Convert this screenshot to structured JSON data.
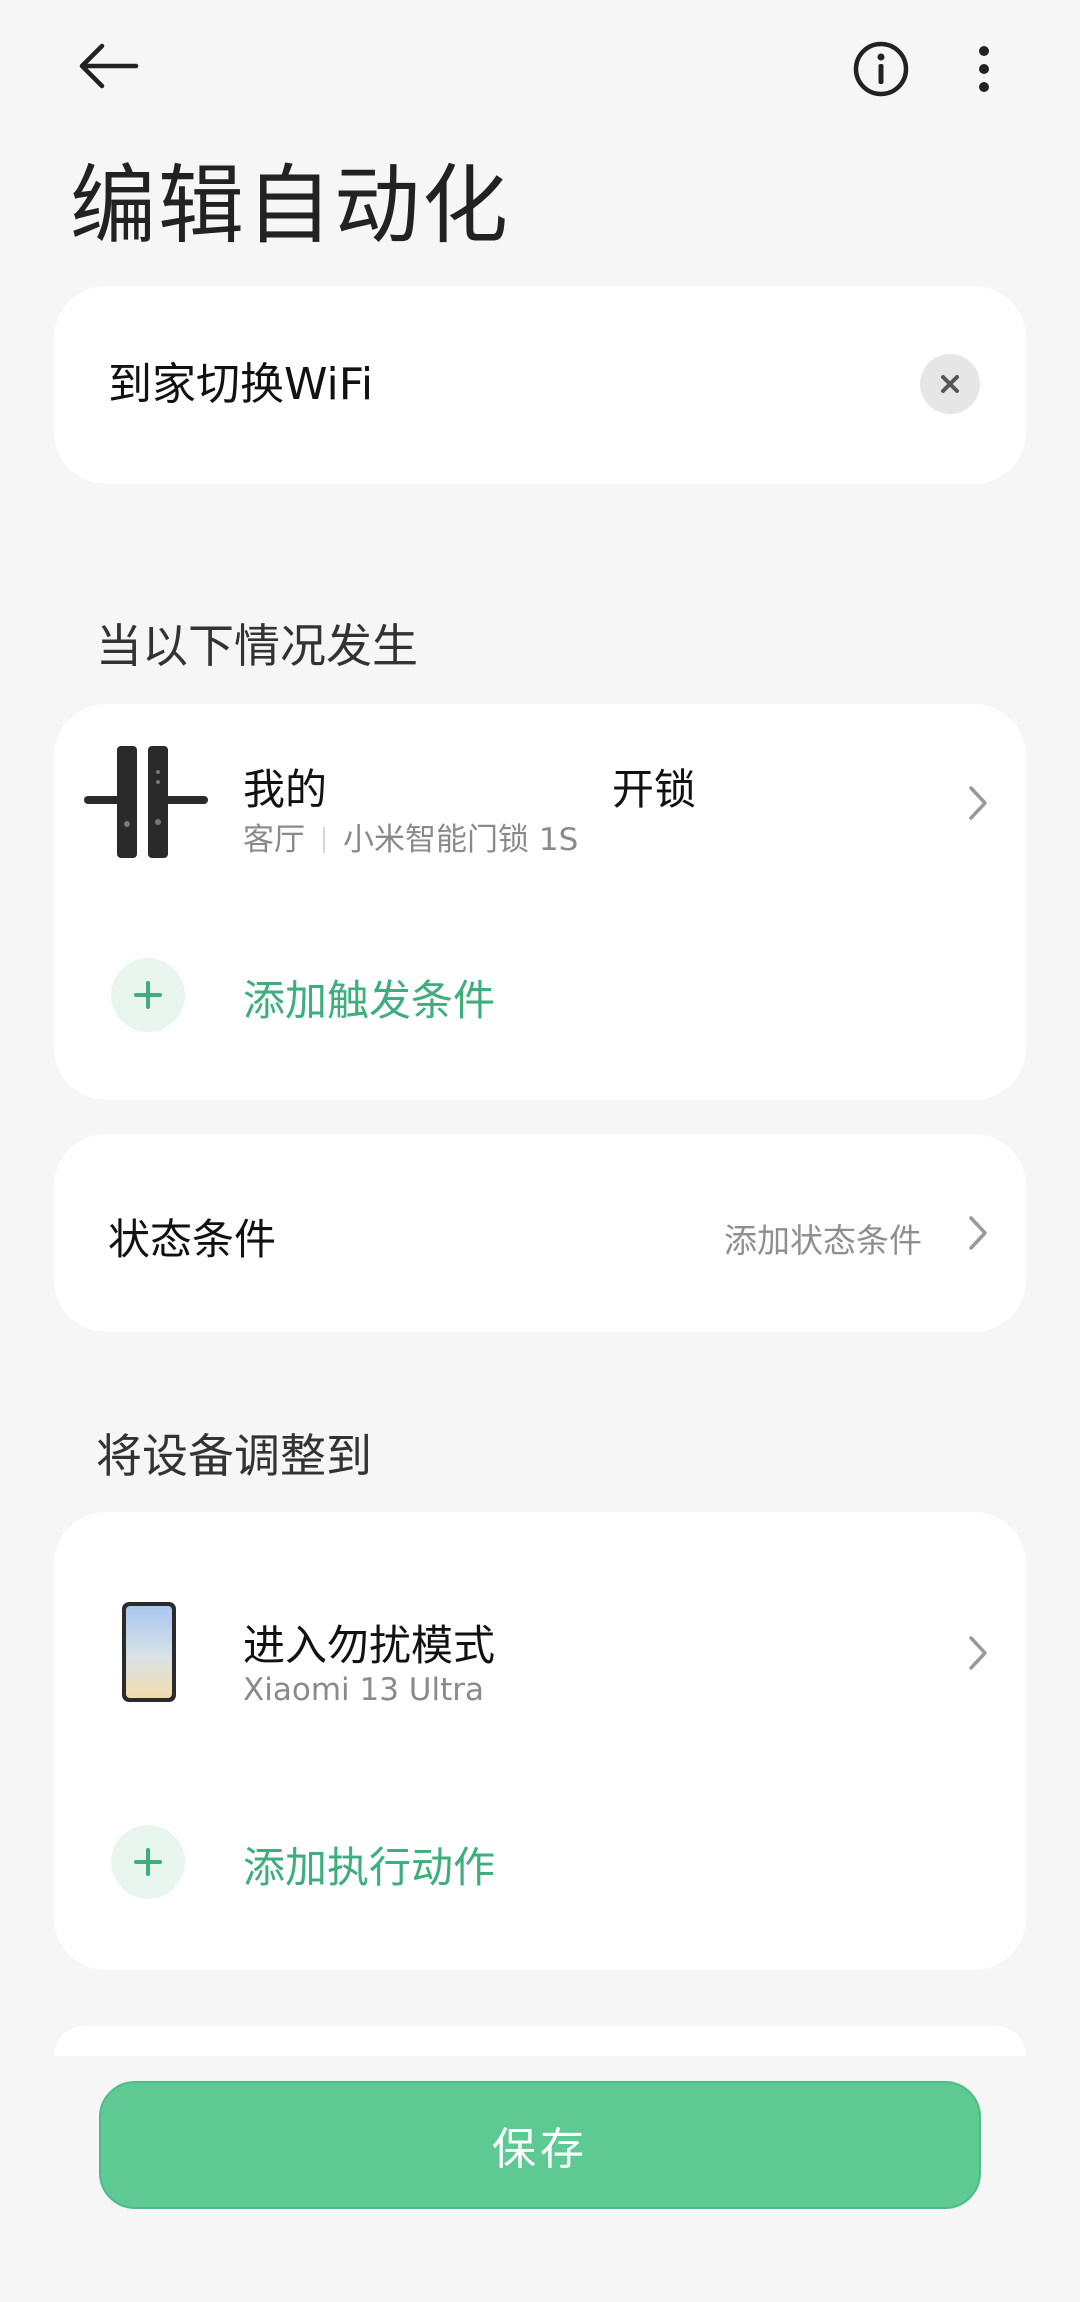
{
  "header": {
    "back_icon": "arrow-left-icon",
    "info_icon": "info-circle-icon",
    "more_icon": "more-vertical-icon",
    "title": "编辑自动化"
  },
  "name_card": {
    "value": "到家切换WiFi",
    "clear_icon": "clear-x-icon"
  },
  "trigger_section": {
    "label": "当以下情况发生",
    "item": {
      "title_prefix": "我的",
      "title_suffix": "开锁",
      "room": "客厅",
      "device": "小米智能门锁 1S",
      "icon": "door-lock-icon"
    },
    "add_label": "添加触发条件"
  },
  "state_card": {
    "label": "状态条件",
    "value": "添加状态条件"
  },
  "action_section": {
    "label": "将设备调整到",
    "item": {
      "title": "进入勿扰模式",
      "device": "Xiaomi 13 Ultra",
      "icon": "phone-icon"
    },
    "add_label": "添加执行动作"
  },
  "footer": {
    "save_label": "保存"
  },
  "colors": {
    "accent": "#3fae7d",
    "save_button": "#5dca94",
    "background": "#f6f6f6"
  }
}
